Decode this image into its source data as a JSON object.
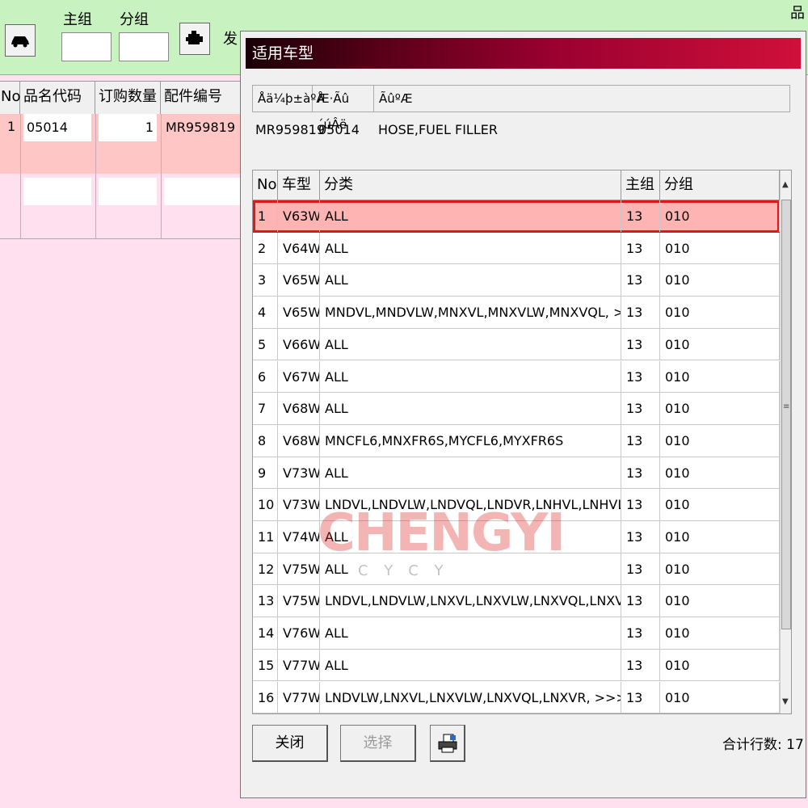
{
  "toolbar": {
    "main_group_label": "主组",
    "sub_group_label": "分组",
    "engine_label": "发",
    "right_partial_label": "品"
  },
  "bg_table": {
    "headers": [
      "No",
      "品名代码",
      "订购数量",
      "配件编号"
    ],
    "row": {
      "no": "1",
      "code": "05014",
      "qty": "1",
      "part": "MR959819"
    }
  },
  "dialog": {
    "title": "适用车型",
    "info_headers": [
      "Åä¼þ±àºÅ",
      "Æ·Ãû´úÂë",
      "ÃûºÆ"
    ],
    "info_values": {
      "part_no": "MR959819",
      "code": "05014",
      "name": "HOSE,FUEL FILLER"
    },
    "grid_headers": [
      "No",
      "车型",
      "分类",
      "主组",
      "分组"
    ],
    "rows": [
      {
        "no": "1",
        "model": "V63W",
        "cls": "ALL",
        "main": "13",
        "sub": "010"
      },
      {
        "no": "2",
        "model": "V64W",
        "cls": "ALL",
        "main": "13",
        "sub": "010"
      },
      {
        "no": "3",
        "model": "V65W",
        "cls": "ALL",
        "main": "13",
        "sub": "010"
      },
      {
        "no": "4",
        "model": "V65W",
        "cls": "MNDVL,MNDVLW,MNXVL,MNXVLW,MNXVQL,  >>>>",
        "main": "13",
        "sub": "010"
      },
      {
        "no": "5",
        "model": "V66W",
        "cls": "ALL",
        "main": "13",
        "sub": "010"
      },
      {
        "no": "6",
        "model": "V67W",
        "cls": "ALL",
        "main": "13",
        "sub": "010"
      },
      {
        "no": "7",
        "model": "V68W",
        "cls": "ALL",
        "main": "13",
        "sub": "010"
      },
      {
        "no": "8",
        "model": "V68W",
        "cls": "MNCFL6,MNXFR6S,MYCFL6,MYXFR6S",
        "main": "13",
        "sub": "010"
      },
      {
        "no": "9",
        "model": "V73W",
        "cls": "ALL",
        "main": "13",
        "sub": "010"
      },
      {
        "no": "10",
        "model": "V73W",
        "cls": "LNDVL,LNDVLW,LNDVQL,LNDVR,LNHVL,LNHVLW,  >>>>",
        "main": "13",
        "sub": "010"
      },
      {
        "no": "11",
        "model": "V74W",
        "cls": "ALL",
        "main": "13",
        "sub": "010"
      },
      {
        "no": "12",
        "model": "V75W",
        "cls": "ALL",
        "main": "13",
        "sub": "010"
      },
      {
        "no": "13",
        "model": "V75W",
        "cls": "LNDVL,LNDVLW,LNXVL,LNXVLW,LNXVQL,LNXVR,  >>>>",
        "main": "13",
        "sub": "010"
      },
      {
        "no": "14",
        "model": "V76W",
        "cls": "ALL",
        "main": "13",
        "sub": "010"
      },
      {
        "no": "15",
        "model": "V77W",
        "cls": "ALL",
        "main": "13",
        "sub": "010"
      },
      {
        "no": "16",
        "model": "V77W",
        "cls": "LNDVLW,LNXVL,LNXVLW,LNXVQL,LNXVR,  >>>>",
        "main": "13",
        "sub": "010"
      }
    ],
    "close_label": "关闭",
    "select_label": "选择",
    "total_label": "合计行数: 17"
  },
  "watermark": {
    "main": "CHENGYI",
    "sub": "CYCY"
  },
  "colors": {
    "toolbar_bg": "#c8f2c0",
    "page_bg": "#ffe0ee",
    "selected_row": "#ffb4b4",
    "selected_border": "#e01818"
  }
}
